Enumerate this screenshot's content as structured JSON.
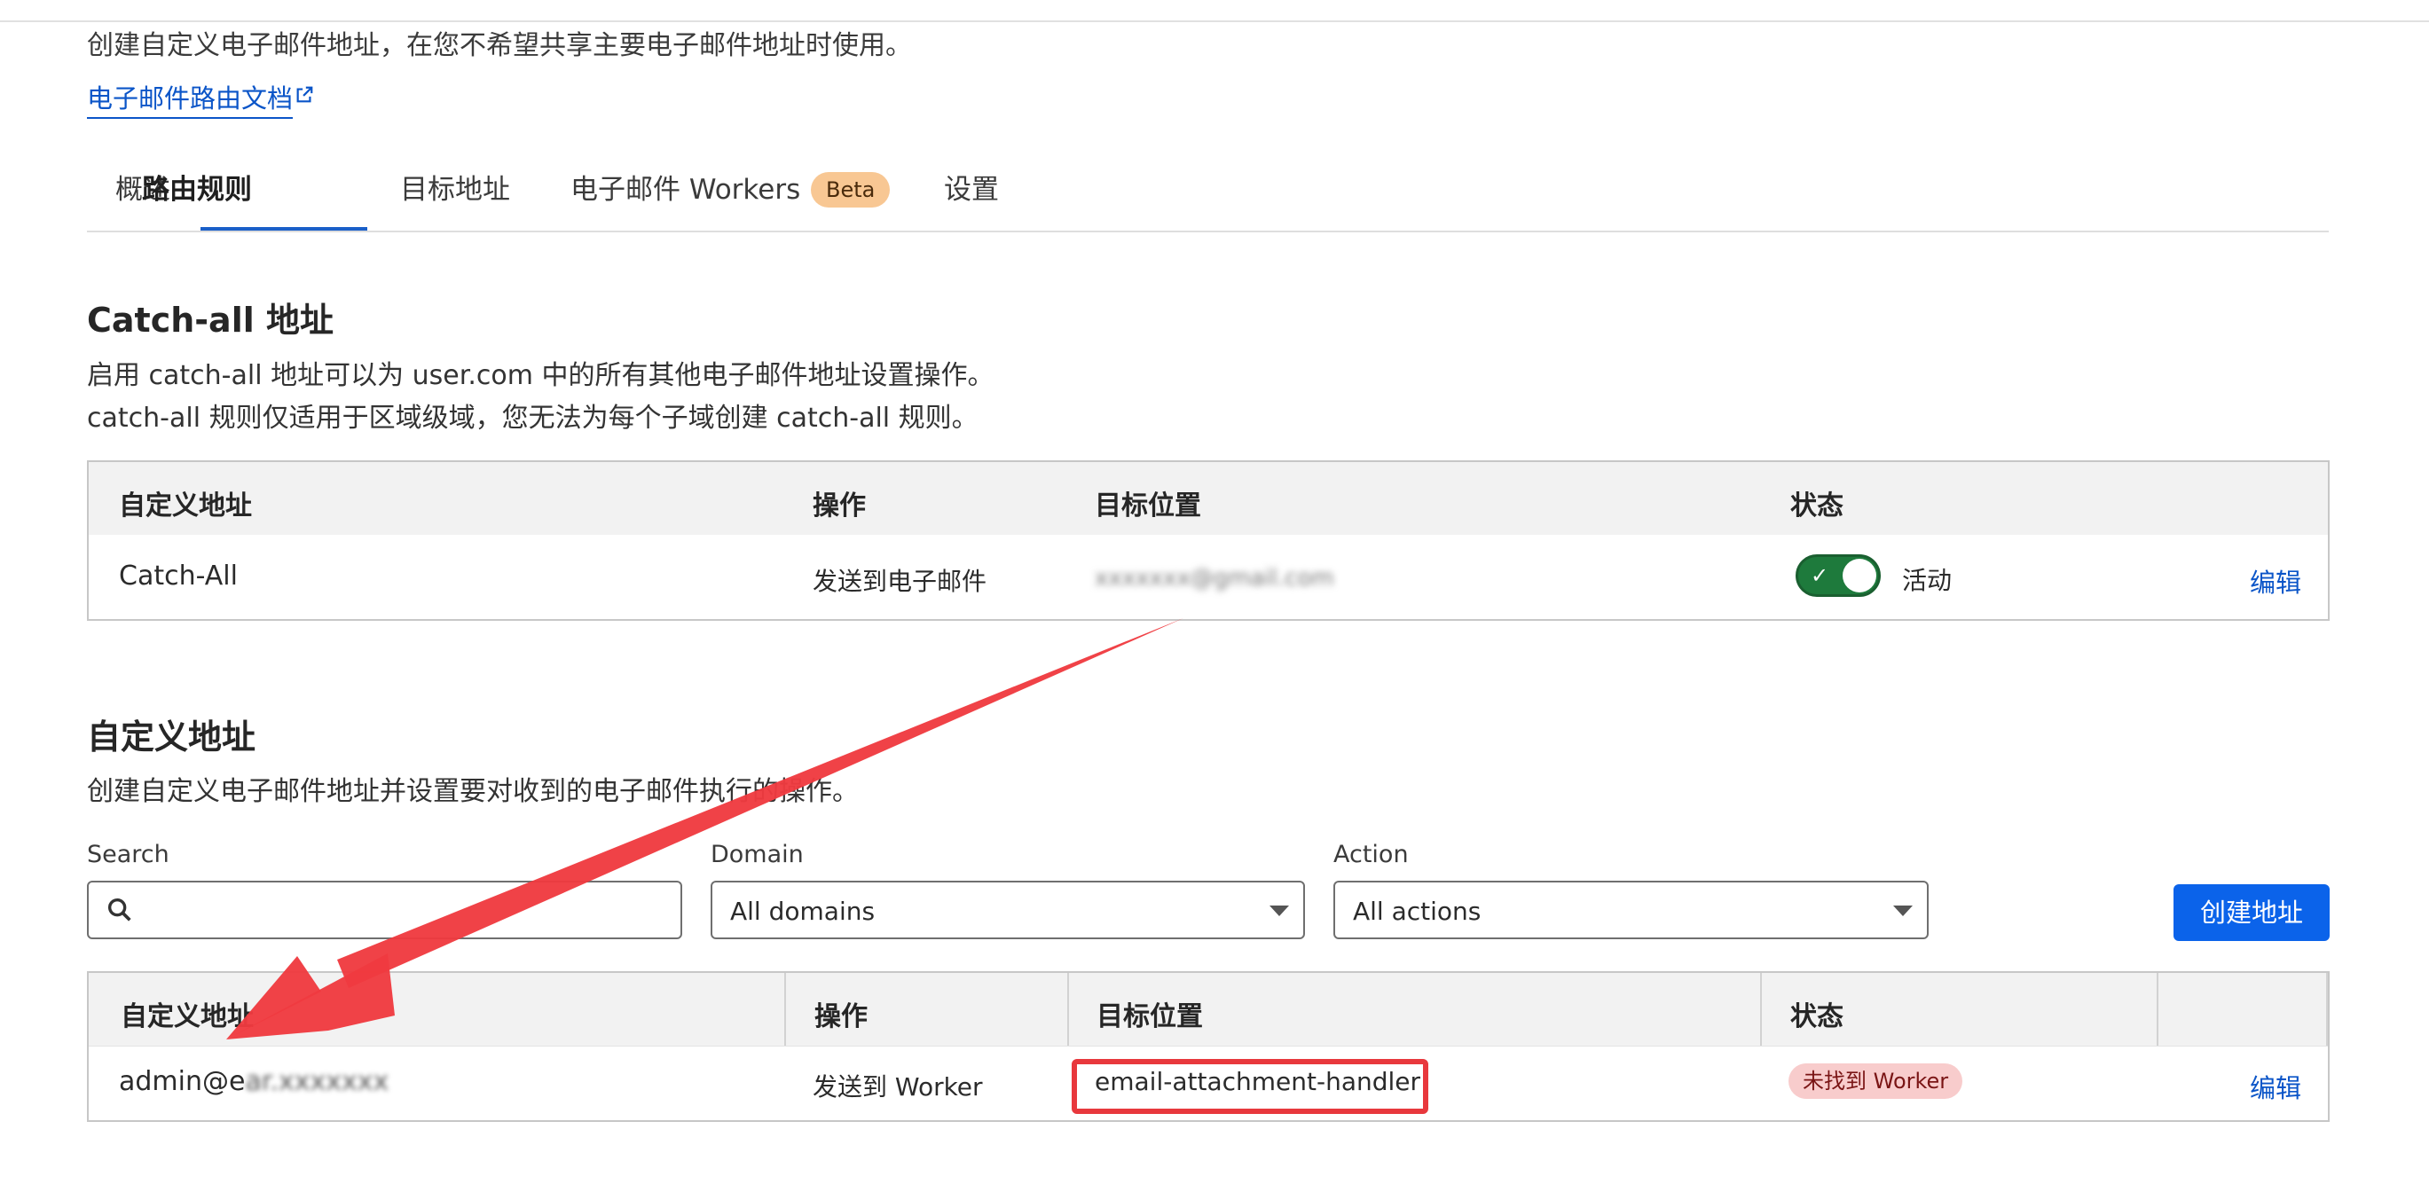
{
  "header": {
    "intro": "创建自定义电子邮件地址，在您不希望共享主要电子邮件地址时使用。",
    "doc_link": "电子邮件路由文档"
  },
  "tabs": [
    {
      "label": "概述"
    },
    {
      "label": "路由规则",
      "active": true
    },
    {
      "label": "目标地址"
    },
    {
      "label": "电子邮件 Workers",
      "badge": "Beta"
    },
    {
      "label": "设置"
    }
  ],
  "catchall": {
    "title": "Catch-all 地址",
    "desc1": "启用 catch-all 地址可以为 user.com 中的所有其他电子邮件地址设置操作。",
    "desc2": "catch-all 规则仅适用于区域级域，您无法为每个子域创建 catch-all 规则。",
    "columns": [
      "自定义地址",
      "操作",
      "目标位置",
      "状态"
    ],
    "row": {
      "address": "Catch-All",
      "action": "发送到电子邮件",
      "destination": "xxxxxxx@gmail.com",
      "status": "活动",
      "edit": "编辑"
    }
  },
  "custom": {
    "title": "自定义地址",
    "desc": "创建自定义电子邮件地址并设置要对收到的电子邮件执行的操作。",
    "filters": {
      "search_label": "Search",
      "search_value": "",
      "domain_label": "Domain",
      "domain_value": "All domains",
      "action_label": "Action",
      "action_value": "All actions"
    },
    "create_button": "创建地址",
    "columns": [
      "自定义地址",
      "操作",
      "目标位置",
      "状态",
      ""
    ],
    "row": {
      "address": "admin@e",
      "address_blurred": "ar.xxxxxxx",
      "action": "发送到 Worker",
      "destination": "email-attachment-handler",
      "status": "未找到 Worker",
      "edit": "编辑"
    }
  },
  "colors": {
    "accent": "#0b63ea",
    "link": "#0b55c8",
    "toggle_on": "#1e7a3c",
    "badge_beta": "#f8c793",
    "badge_error": "#f8cccc",
    "annotation": "#e8383d"
  }
}
